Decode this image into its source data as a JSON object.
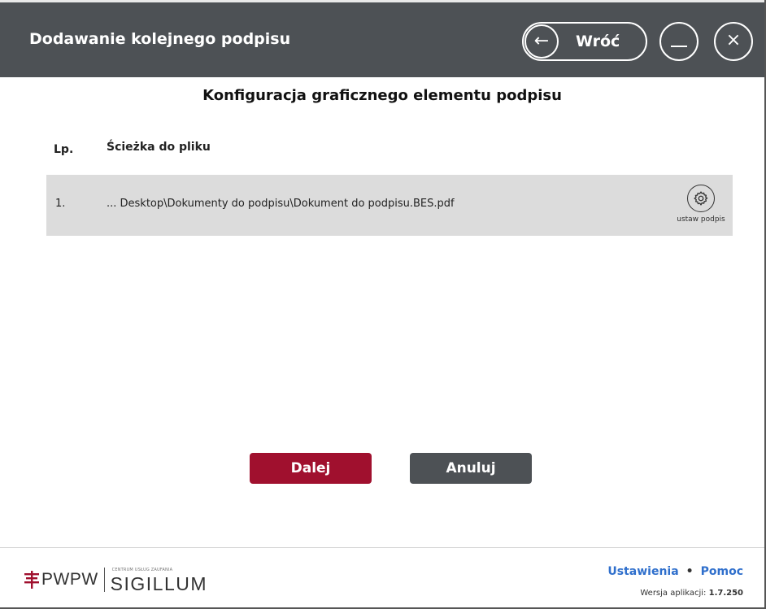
{
  "window": {
    "title": "Dodawanie kolejnego podpisu"
  },
  "header": {
    "back_label": "Wróć",
    "back_icon": "arrow-left-icon",
    "minimize_icon": "minimize-icon",
    "close_icon": "close-icon"
  },
  "main": {
    "heading": "Konfiguracja graficznego elementu podpisu",
    "table": {
      "columns": [
        "Lp.",
        "Ścieżka do pliku"
      ],
      "rows": [
        {
          "num": "1.",
          "path": "... Desktop\\Dokumenty do podpisu\\Dokument do podpisu.BES.pdf",
          "action_label": "ustaw podpis",
          "action_icon": "gear-icon"
        }
      ]
    }
  },
  "actions": {
    "next_label": "Dalej",
    "cancel_label": "Anuluj"
  },
  "footer": {
    "logo": {
      "pwpw": "PWPW",
      "small_text": "CENTRUM USŁUG ZAUFANIA",
      "sigillum": "SIGILLUM"
    },
    "links": {
      "settings": "Ustawienia",
      "separator": "•",
      "help": "Pomoc"
    },
    "version_label": "Wersja aplikacji:",
    "version_value": "1.7.250"
  },
  "colors": {
    "titlebar": "#4d5155",
    "primary_button": "#a0102e",
    "secondary_button": "#4d5155",
    "link": "#2f6fcc",
    "row_bg": "#dcdcdc",
    "logo_accent": "#a0102e"
  }
}
